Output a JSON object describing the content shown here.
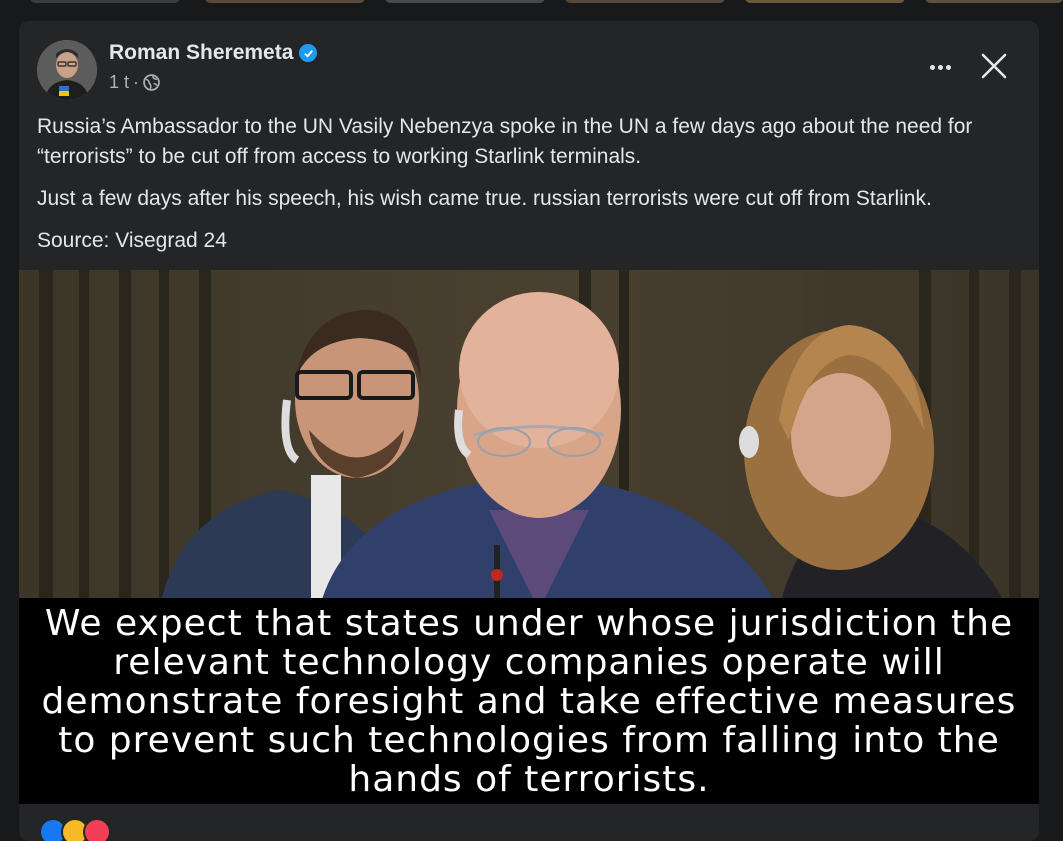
{
  "post": {
    "author": "Roman Sheremeta",
    "time": "1 t",
    "paragraphs": [
      "Russia’s Ambassador to the UN Vasily Nebenzya spoke in the UN a few days ago about the need for “terrorists” to be cut off from access to working Starlink terminals.",
      "Just a few days after his speech, his wish came true. russian terrorists were cut off from Starlink.",
      "Source: Visegrad 24"
    ]
  },
  "video": {
    "subtitle": "We expect that states under whose jurisdiction the relevant technology companies operate will demonstrate foresight and take effective measures to prevent such technologies from falling into the hands of terrorists."
  },
  "icons": {
    "verified": "verified-badge-icon",
    "privacy": "globe-icon",
    "more": "more-options-icon",
    "close": "close-icon"
  },
  "colors": {
    "background": "#18191a",
    "card": "#242526",
    "verified": "#1d9bf0"
  }
}
